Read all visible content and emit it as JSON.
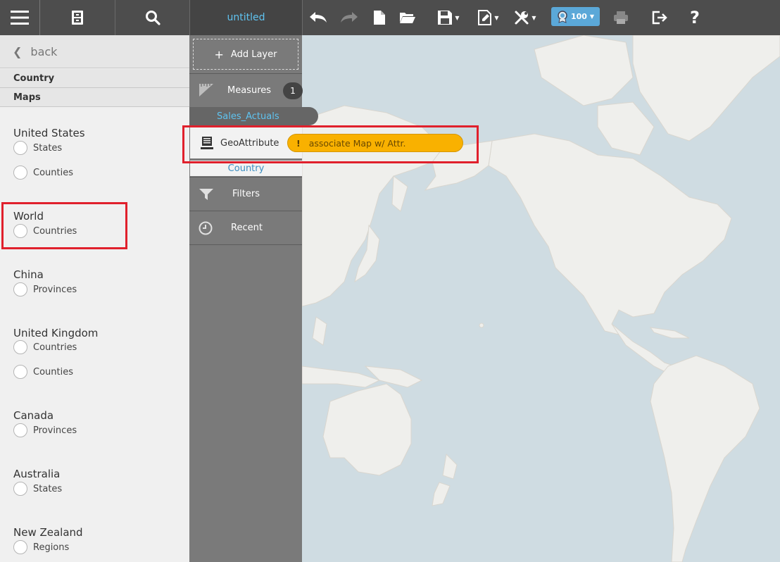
{
  "toolbar": {
    "title": "untitled",
    "badge_value": "100",
    "icons": [
      "menu-icon",
      "file-cabinet-icon",
      "search-icon",
      "undo-icon",
      "redo-icon",
      "new-document-icon",
      "open-folder-icon",
      "save-icon",
      "edit-page-icon",
      "tools-icon",
      "award-icon",
      "print-icon",
      "exit-icon",
      "help-icon"
    ]
  },
  "left_panel": {
    "back_label": "back",
    "breadcrumb": [
      "Country",
      "Maps"
    ],
    "groups": [
      {
        "title": "United States",
        "options": [
          "States",
          "Counties"
        ]
      },
      {
        "title": "World",
        "options": [
          "Countries"
        ]
      },
      {
        "title": "China",
        "options": [
          "Provinces"
        ]
      },
      {
        "title": "United Kingdom",
        "options": [
          "Countries",
          "Counties"
        ]
      },
      {
        "title": "Canada",
        "options": [
          "Provinces"
        ]
      },
      {
        "title": "Australia",
        "options": [
          "States"
        ]
      },
      {
        "title": "New Zealand",
        "options": [
          "Regions"
        ]
      }
    ]
  },
  "layer_panel": {
    "add_layer_label": "Add Layer",
    "measures_label": "Measures",
    "measures_count": "1",
    "measure_field": "Sales_Actuals",
    "geo_label": "GeoAttribute",
    "geo_field": "Country",
    "warning_label": "associate Map w/ Attr.",
    "warning_mark": "!",
    "filters_label": "Filters",
    "recent_label": "Recent"
  },
  "colors": {
    "toolbar_bg": "#4d4d4d",
    "accent_blue": "#5fc3f0",
    "warning": "#f9b100",
    "highlight": "#e0202c",
    "ocean": "#cfdce2",
    "land": "#efefec"
  }
}
